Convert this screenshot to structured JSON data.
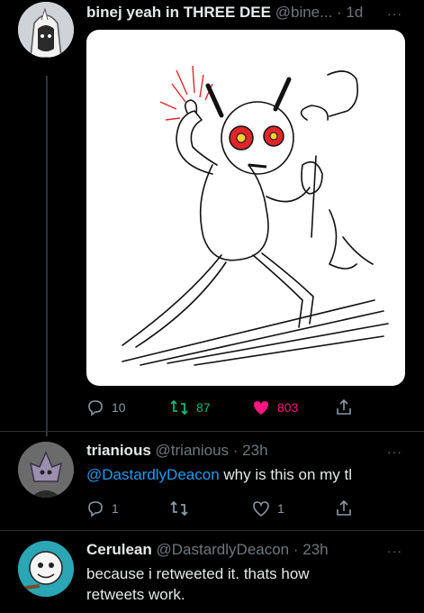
{
  "tweets": [
    {
      "name": "binej yeah in THREE DEE",
      "handle": "@bine...",
      "time": "· 1d",
      "more": "···",
      "stats": {
        "replies": "10",
        "retweets": "87",
        "likes": "803"
      },
      "colors": {
        "retweet": "#00ba7c",
        "like": "#f91880"
      }
    },
    {
      "name": "trianious",
      "handle": "@trianious",
      "time": "· 23h",
      "more": "···",
      "mention": "@DastardlyDeacon",
      "text": " why is this on my tl",
      "stats": {
        "replies": "1",
        "retweets": "",
        "likes": "1"
      }
    },
    {
      "name": "Cerulean",
      "handle": "@DastardlyDeacon",
      "time": "· 23h",
      "more": "···",
      "text_line1": "because i retweeted it. thats how",
      "text_line2": "retweets work."
    }
  ],
  "icons": [
    "reply-icon",
    "retweet-icon",
    "like-icon",
    "share-icon",
    "more-icon"
  ],
  "accent": "#1d9bf0"
}
